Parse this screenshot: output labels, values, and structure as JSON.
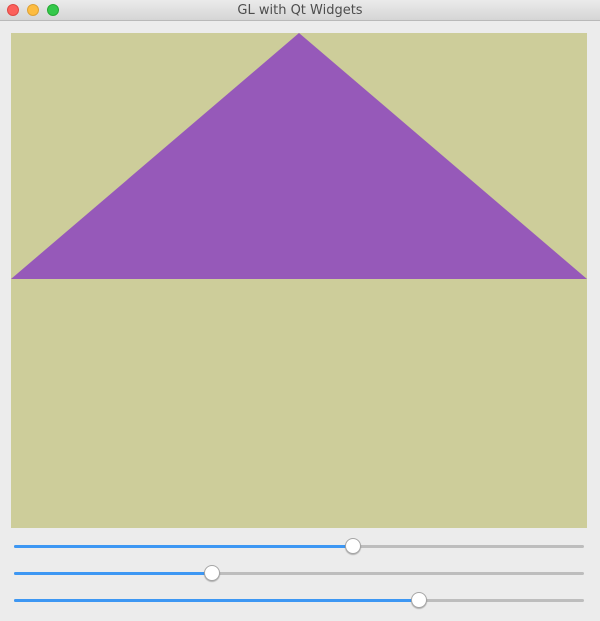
{
  "window": {
    "title": "GL with Qt Widgets",
    "controls": [
      "close-icon",
      "minimize-icon",
      "maximize-icon"
    ]
  },
  "gl_view": {
    "background_color": "#cdcd9a",
    "triangle_color": "#9659b9"
  },
  "sliders": [
    {
      "name": "slider-1",
      "value": 0.594
    },
    {
      "name": "slider-2",
      "value": 0.347
    },
    {
      "name": "slider-3",
      "value": 0.711
    }
  ],
  "slider_colors": {
    "fill": "#3d97f3",
    "track": "#bdbdbd"
  }
}
